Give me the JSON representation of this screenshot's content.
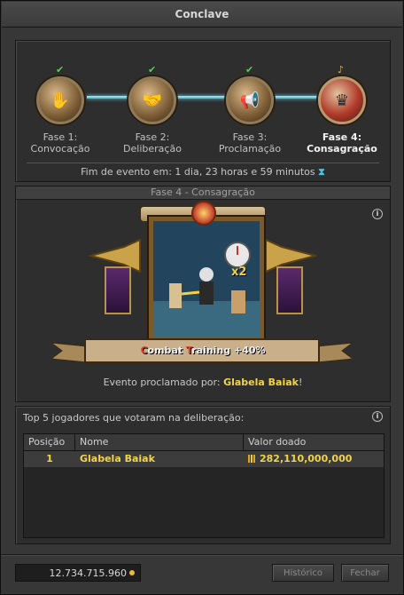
{
  "window": {
    "title": "Conclave"
  },
  "phases": [
    {
      "label_line1": "Fase 1:",
      "label_line2": "Convocação",
      "status": "done",
      "status_mark": "✔"
    },
    {
      "label_line1": "Fase 2:",
      "label_line2": "Deliberação",
      "status": "done",
      "status_mark": "✔"
    },
    {
      "label_line1": "Fase 3:",
      "label_line2": "Proclamação",
      "status": "done",
      "status_mark": "✔"
    },
    {
      "label_line1": "Fase 4:",
      "label_line2": "Consagração",
      "status": "current",
      "status_mark": "♪"
    }
  ],
  "deadline": {
    "text": "Fim de evento em: 1 dia, 23 horas e 59 minutos",
    "icon": "hourglass-icon",
    "icon_glyph": "⧗"
  },
  "stage": {
    "title": "Fase 4 - Consagração",
    "artwork_icon": "combat-training-artwork",
    "multiplier": "x2",
    "bonus_text": "Combat Training +40%",
    "proclaimed_label": "Evento proclamado por:",
    "proclaimed_name": "Glabela Baiak",
    "proclaimed_suffix": "!"
  },
  "top5": {
    "caption": "Top 5 jogadores que votaram na deliberação:",
    "columns": [
      "Posição",
      "Nome",
      "Valor doado"
    ],
    "rows": [
      {
        "position": "1",
        "name": "Glabela Baiak",
        "value": "282,110,000,000"
      }
    ]
  },
  "footer": {
    "balance": "12.734.715.960",
    "history_label": "Histórico",
    "close_label": "Fechar"
  },
  "colors": {
    "highlight_name": "#f2d44a",
    "done_check": "#56d14a",
    "connector": "#6fd6ea",
    "bonus_initial": "#e0473a"
  }
}
